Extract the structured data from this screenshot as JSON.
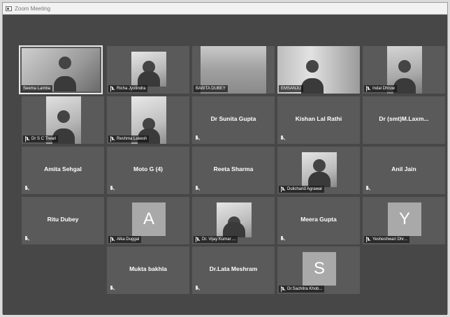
{
  "window": {
    "title": "Zoom Meeting"
  },
  "participants": {
    "p1": {
      "name": "Seema Lamba"
    },
    "p2": {
      "name": "Richa Jyotindra"
    },
    "p3": {
      "name": "BABITA DUBEY"
    },
    "p4": {
      "name": "EMSANJU"
    },
    "p5": {
      "name": "Indal Dhruw"
    },
    "p6": {
      "name": "Dr S C Tiwari"
    },
    "p7": {
      "name": "Reshma Lakesh"
    },
    "p8": {
      "name": "Dr Sunita Gupta"
    },
    "p9": {
      "name": "Kishan Lal Rathi"
    },
    "p10": {
      "name": "Dr (smt)M.Laxm..."
    },
    "p11": {
      "name": "Amita Sehgal"
    },
    "p12": {
      "name": "Moto G (4)"
    },
    "p13": {
      "name": "Reeta Sharma"
    },
    "p14": {
      "name": "Dulichand Agrawal"
    },
    "p15": {
      "name": "Anil Jain"
    },
    "p16": {
      "name": "Ritu Dubey"
    },
    "p17": {
      "name": "Alka Duggal",
      "initial": "A"
    },
    "p18": {
      "name": "Dr. Vijay Kumar ..."
    },
    "p19": {
      "name": "Meera Gupta"
    },
    "p20": {
      "name": "Yesheshwari Dhr...",
      "initial": "Y"
    },
    "p21": {
      "name": "Mukta bakhla"
    },
    "p22": {
      "name": "Dr.Lata Meshram"
    },
    "p23": {
      "name": "Dr.Sachitra Khob...",
      "initial": "S"
    }
  }
}
